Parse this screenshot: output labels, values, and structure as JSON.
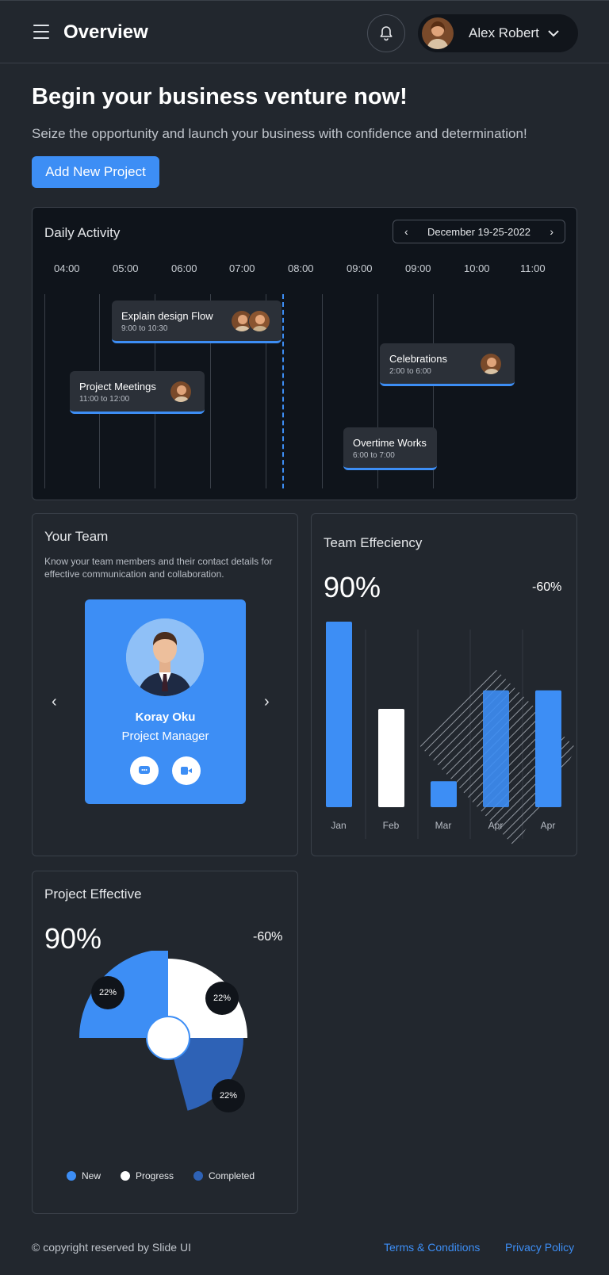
{
  "header": {
    "title": "Overview",
    "user_name": "Alex Robert"
  },
  "hero": {
    "title": "Begin your business venture now!",
    "subtitle": "Seize the opportunity and launch your business with confidence and determination!",
    "add_button_label": "Add New Project"
  },
  "daily_activity": {
    "title": "Daily Activity",
    "date_range": "December 19-25-2022",
    "times": [
      "04:00",
      "05:00",
      "06:00",
      "07:00",
      "08:00",
      "09:00",
      "09:00",
      "10:00",
      "11:00"
    ],
    "events": [
      {
        "title": "Explain design Flow",
        "time": "9:00 to 10:30"
      },
      {
        "title": "Project Meetings",
        "time": "11:00 to 12:00"
      },
      {
        "title": "Celebrations",
        "time": "2:00 to 6:00"
      },
      {
        "title": "Overtime Works",
        "time": "6:00 to 7:00"
      }
    ]
  },
  "your_team": {
    "title": "Your Team",
    "description": "Know your team members and their contact details for effective communication and collaboration.",
    "member": {
      "name": "Koray Oku",
      "role": "Project Manager"
    }
  },
  "team_efficiency": {
    "title": "Team Effeciency",
    "value": "90%",
    "change": "-60%",
    "chart_data": {
      "type": "bar",
      "categories": [
        "Jan",
        "Feb",
        "Mar",
        "Apr",
        "Apr"
      ],
      "values": [
        100,
        53,
        14,
        63,
        63
      ],
      "colors": [
        "#3d8ef5",
        "#ffffff",
        "#3d8ef5",
        "#3d8ef5",
        "#3d8ef5"
      ],
      "ylim": [
        0,
        100
      ]
    }
  },
  "project_effective": {
    "title": "Project Effective",
    "value": "90%",
    "change": "-60%",
    "chart_data": {
      "type": "pie",
      "labels": [
        "New",
        "Progress",
        "Completed"
      ],
      "values": [
        22,
        22,
        22
      ],
      "value_labels": [
        "22%",
        "22%",
        "22%"
      ],
      "colors": [
        "#3d8ef5",
        "#ffffff",
        "#2e62b6"
      ]
    }
  },
  "footer": {
    "copyright": "© copyright reserved by Slide UI",
    "terms": "Terms & Conditions",
    "privacy": "Privacy Policy"
  }
}
